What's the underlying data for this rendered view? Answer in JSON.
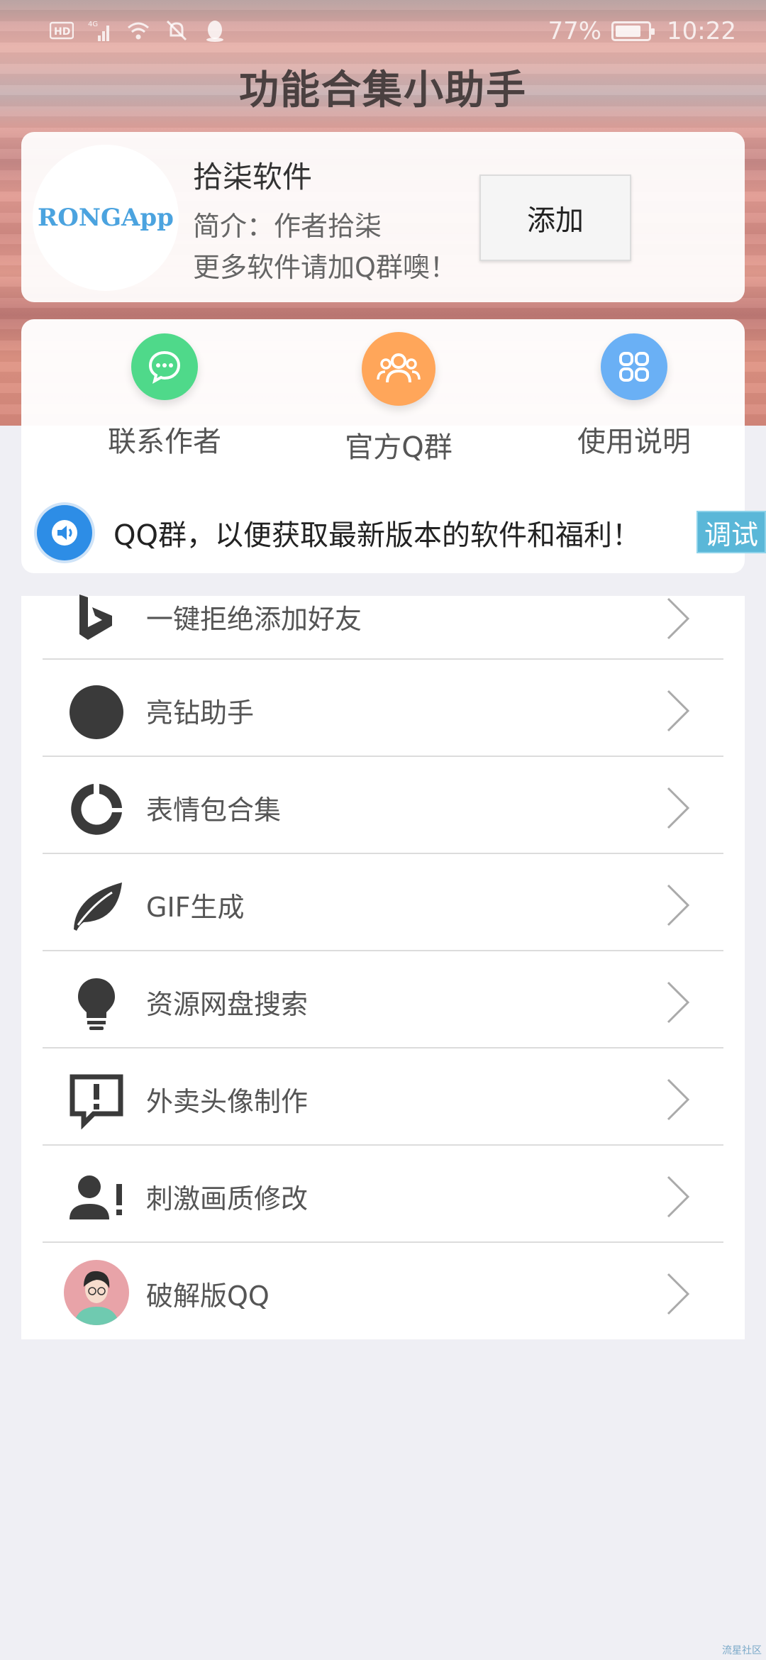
{
  "status_bar": {
    "left_icons": [
      "hd-icon",
      "signal-4g-icon",
      "wifi-icon",
      "mute-icon",
      "qq-penguin-icon"
    ],
    "left_badges": {
      "hd": "HD",
      "network": "4G"
    },
    "battery_percent": "77%",
    "time": "10:22"
  },
  "page": {
    "title": "功能合集小助手"
  },
  "profile": {
    "logo_text": "RONGApp",
    "name": "拾柒软件",
    "intro_line1": "简介：作者拾柒",
    "intro_line2": "更多软件请加Q群噢！",
    "add_label": "添加"
  },
  "shortcuts": [
    {
      "label": "联系作者",
      "icon": "chat-bubble-icon",
      "color": "#4fd98a"
    },
    {
      "label": "官方Q群",
      "icon": "group-icon",
      "color": "#ffa65a"
    },
    {
      "label": "使用说明",
      "icon": "grid-apps-icon",
      "color": "#6ab0f5"
    }
  ],
  "marquee": {
    "text": "QQ群，以便获取最新版本的软件和福利！",
    "icon": "speaker-icon"
  },
  "debug_label": "调试",
  "menu": [
    {
      "label": "一键拒绝添加好友",
      "icon": "bing-icon"
    },
    {
      "label": "亮钻助手",
      "icon": "filled-circle-icon"
    },
    {
      "label": "表情包合集",
      "icon": "ring-icon"
    },
    {
      "label": "GIF生成",
      "icon": "leaf-icon"
    },
    {
      "label": "资源网盘搜索",
      "icon": "lightbulb-icon"
    },
    {
      "label": "外卖头像制作",
      "icon": "alert-message-icon"
    },
    {
      "label": "刺激画质修改",
      "icon": "person-alert-icon"
    },
    {
      "label": "破解版QQ",
      "icon": "avatar-photo-icon"
    }
  ],
  "watermark": "流星社区",
  "colors": {
    "accent_blue": "#2d8de6",
    "debug_tag": "#5ab7d8",
    "logo_blue": "#4ba3df"
  }
}
